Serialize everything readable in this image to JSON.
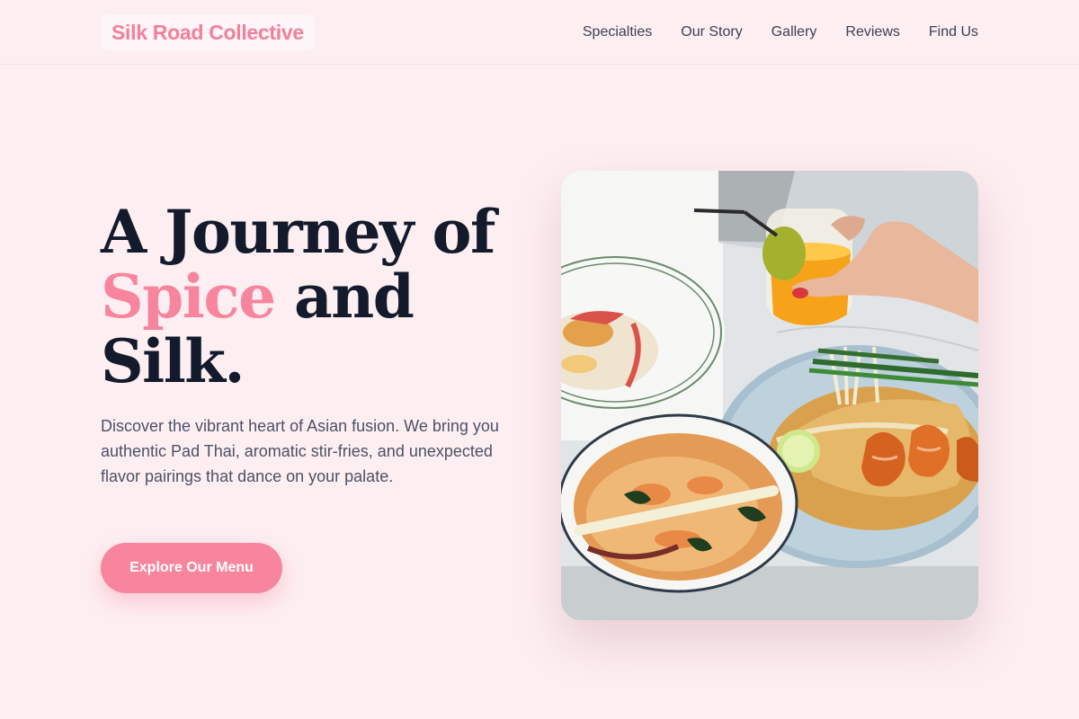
{
  "header": {
    "logo": "Silk Road Collective",
    "nav": [
      "Specialties",
      "Our Story",
      "Gallery",
      "Reviews",
      "Find Us"
    ]
  },
  "hero": {
    "headline_line1": "A Journey of",
    "headline_accent": "Spice",
    "headline_line2_rest": "and",
    "headline_line3": "Silk.",
    "description": "Discover the vibrant heart of Asian fusion. We bring you authentic Pad Thai, aromatic stir-fries, and unexpected flavor pairings that dance on your palate.",
    "cta_label": "Explore Our Menu"
  },
  "colors": {
    "background": "#fdeef1",
    "accent": "#f7859e",
    "heading": "#131a2b",
    "body_text": "#4b5266"
  },
  "image": {
    "subject": "food-photo-asian-dishes"
  }
}
